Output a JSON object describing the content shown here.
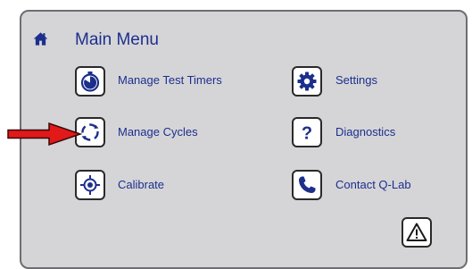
{
  "header": {
    "title": "Main Menu",
    "home_icon": "home-icon"
  },
  "menu": {
    "manage_test_timers": {
      "label": "Manage Test Timers",
      "icon": "stopwatch-icon"
    },
    "manage_cycles": {
      "label": "Manage Cycles",
      "icon": "cycle-icon"
    },
    "calibrate": {
      "label": "Calibrate",
      "icon": "crosshair-icon"
    },
    "settings": {
      "label": "Settings",
      "icon": "gear-icon"
    },
    "diagnostics": {
      "label": "Diagnostics",
      "icon": "question-icon"
    },
    "contact": {
      "label": "Contact Q-Lab",
      "icon": "phone-icon"
    }
  },
  "warning": {
    "icon": "warning-icon"
  },
  "annotation": {
    "icon": "red-arrow-icon",
    "color": "#e11919"
  },
  "colors": {
    "text": "#1c2f8c",
    "panel": "#d5d5d8",
    "border": "#6e6e72",
    "icon": "#1c2f8c"
  }
}
